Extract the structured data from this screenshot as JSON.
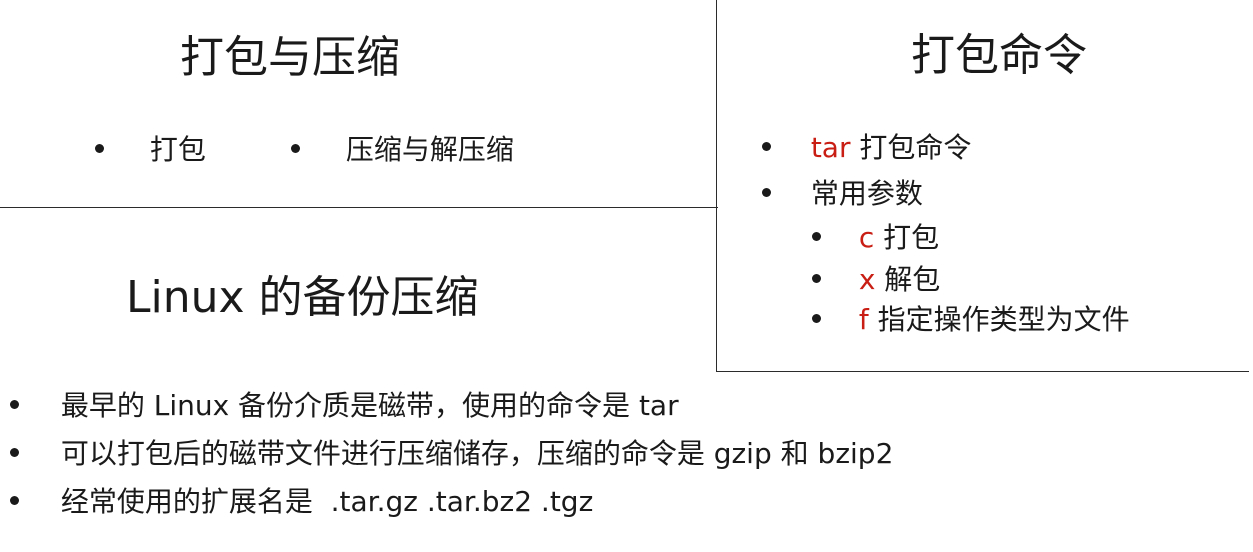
{
  "panel_pack_compress": {
    "title": "打包与压缩",
    "items": [
      "打包",
      "压缩与解压缩"
    ]
  },
  "panel_pack_command": {
    "title": "打包命令",
    "items": [
      {
        "keyword": "tar",
        "text": "打包命令"
      },
      {
        "keyword": "",
        "text": "常用参数"
      }
    ],
    "params": [
      {
        "flag": "c",
        "desc": "打包"
      },
      {
        "flag": "x",
        "desc": "解包"
      },
      {
        "flag": "f",
        "desc": "指定操作类型为文件"
      }
    ],
    "accent_color": "#c81e14"
  },
  "panel_linux_backup": {
    "title": "Linux 的备份压缩",
    "items": [
      "最早的 Linux 备份介质是磁带，使用的命令是 tar",
      "可以打包后的磁带文件进行压缩储存，压缩的命令是 gzip 和 bzip2",
      "经常使用的扩展名是  .tar.gz .tar.bz2 .tgz"
    ]
  }
}
